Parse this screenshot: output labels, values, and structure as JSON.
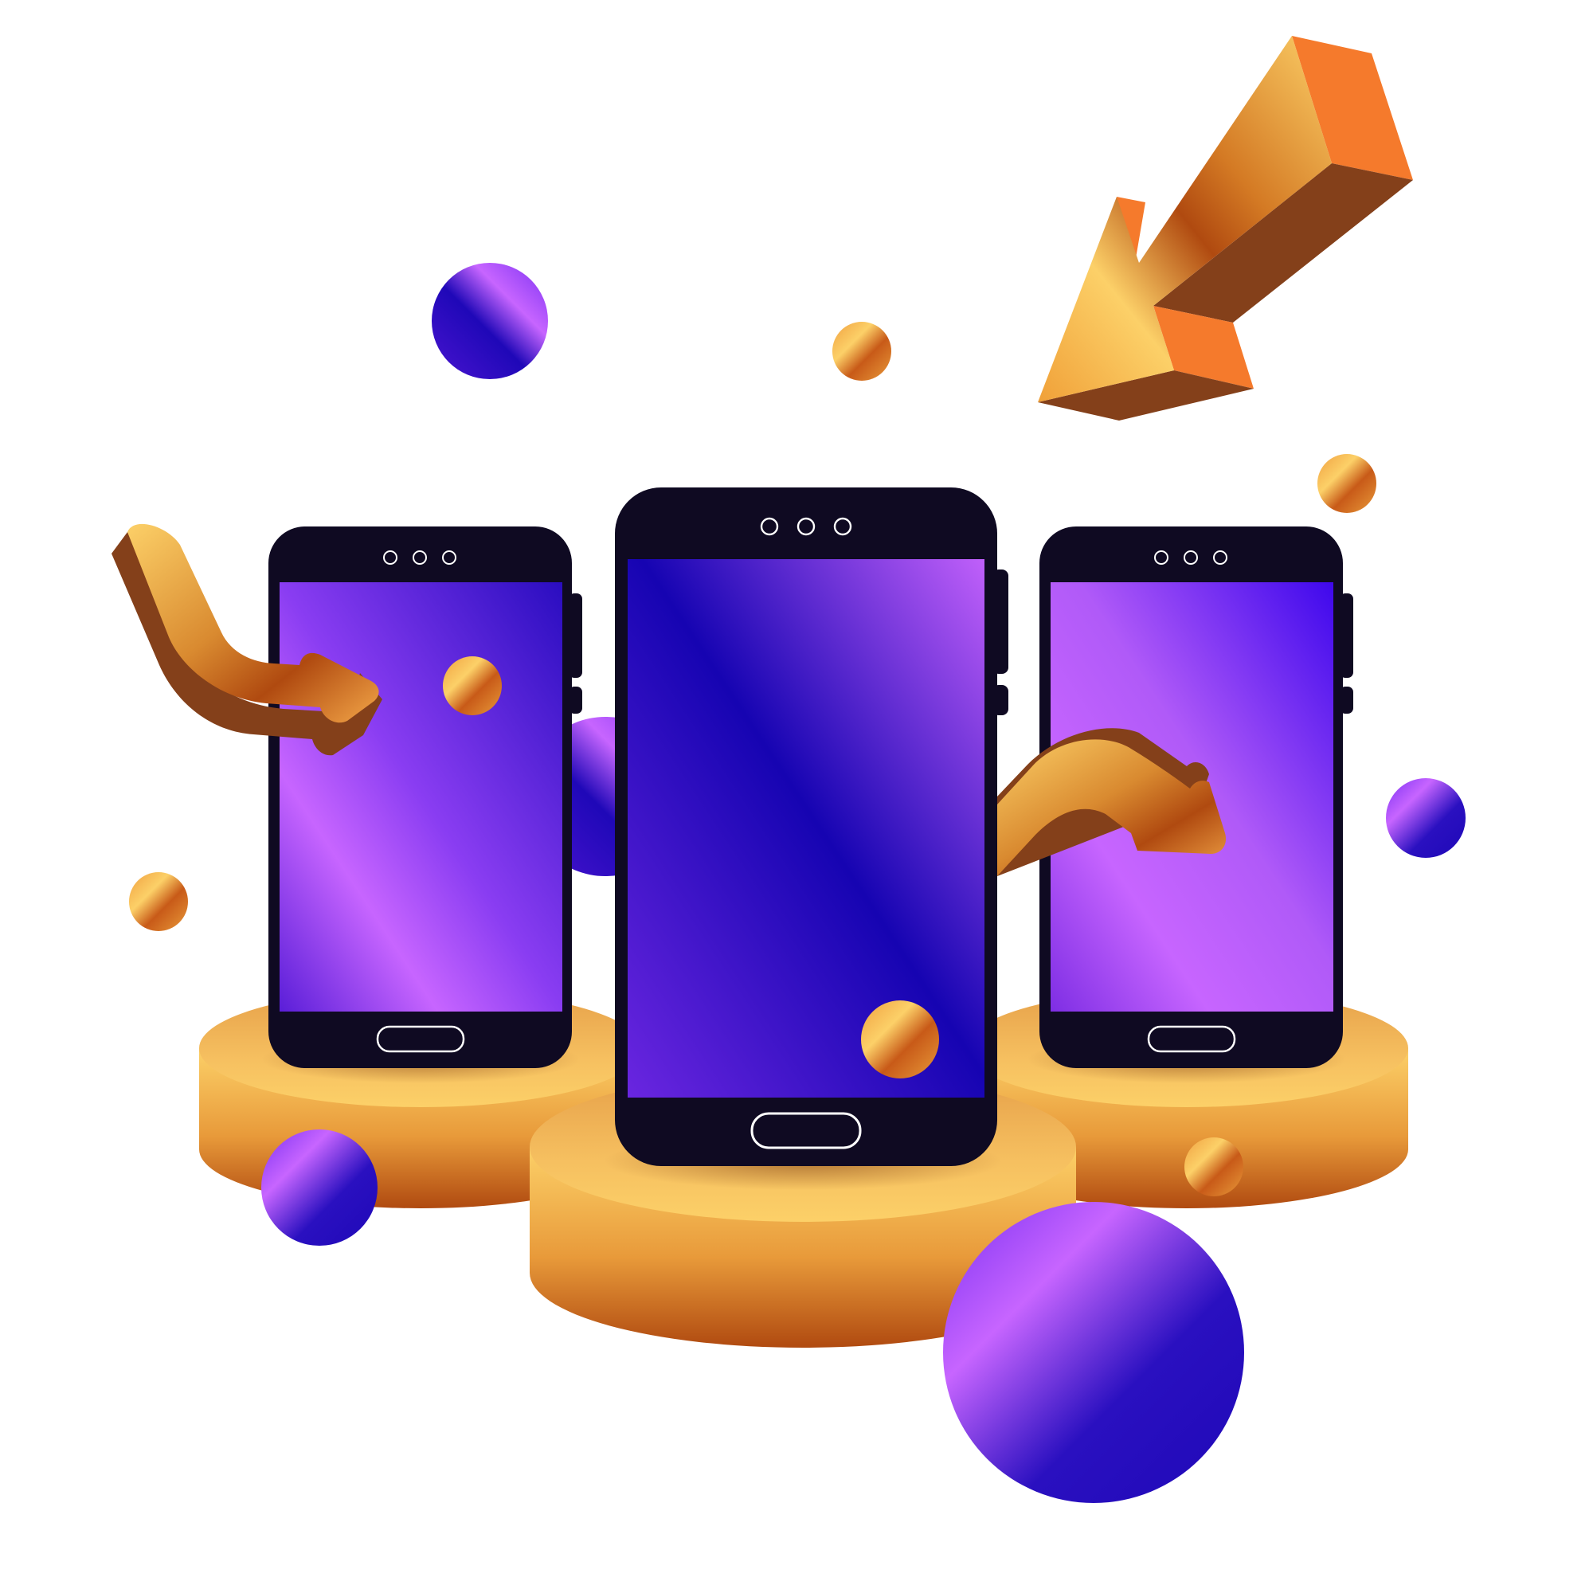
{
  "colors": {
    "background": "#ffffff",
    "phone_body": "#0f0a22",
    "purple_light": "#c765ff",
    "purple_mid": "#7b2ff0",
    "indigo_dark": "#1f08b8",
    "gold_light": "#fcd068",
    "gold_mid": "#e89a3a",
    "gold_dark": "#b04a10",
    "orange": "#f57a2c",
    "brown": "#84401a"
  },
  "scene": {
    "phones": [
      {
        "name": "left-phone",
        "screen_gradient": "purple-to-indigo"
      },
      {
        "name": "center-phone",
        "screen_gradient": "indigo-diagonal"
      },
      {
        "name": "right-phone",
        "screen_gradient": "purple-to-indigo"
      }
    ],
    "icons": [
      "curved-arrow-left",
      "curved-arrow-right",
      "diagonal-arrow-top-right"
    ],
    "objects": [
      "pedestal-left",
      "pedestal-center",
      "pedestal-right",
      "purple-spheres",
      "gold-spheres"
    ]
  }
}
